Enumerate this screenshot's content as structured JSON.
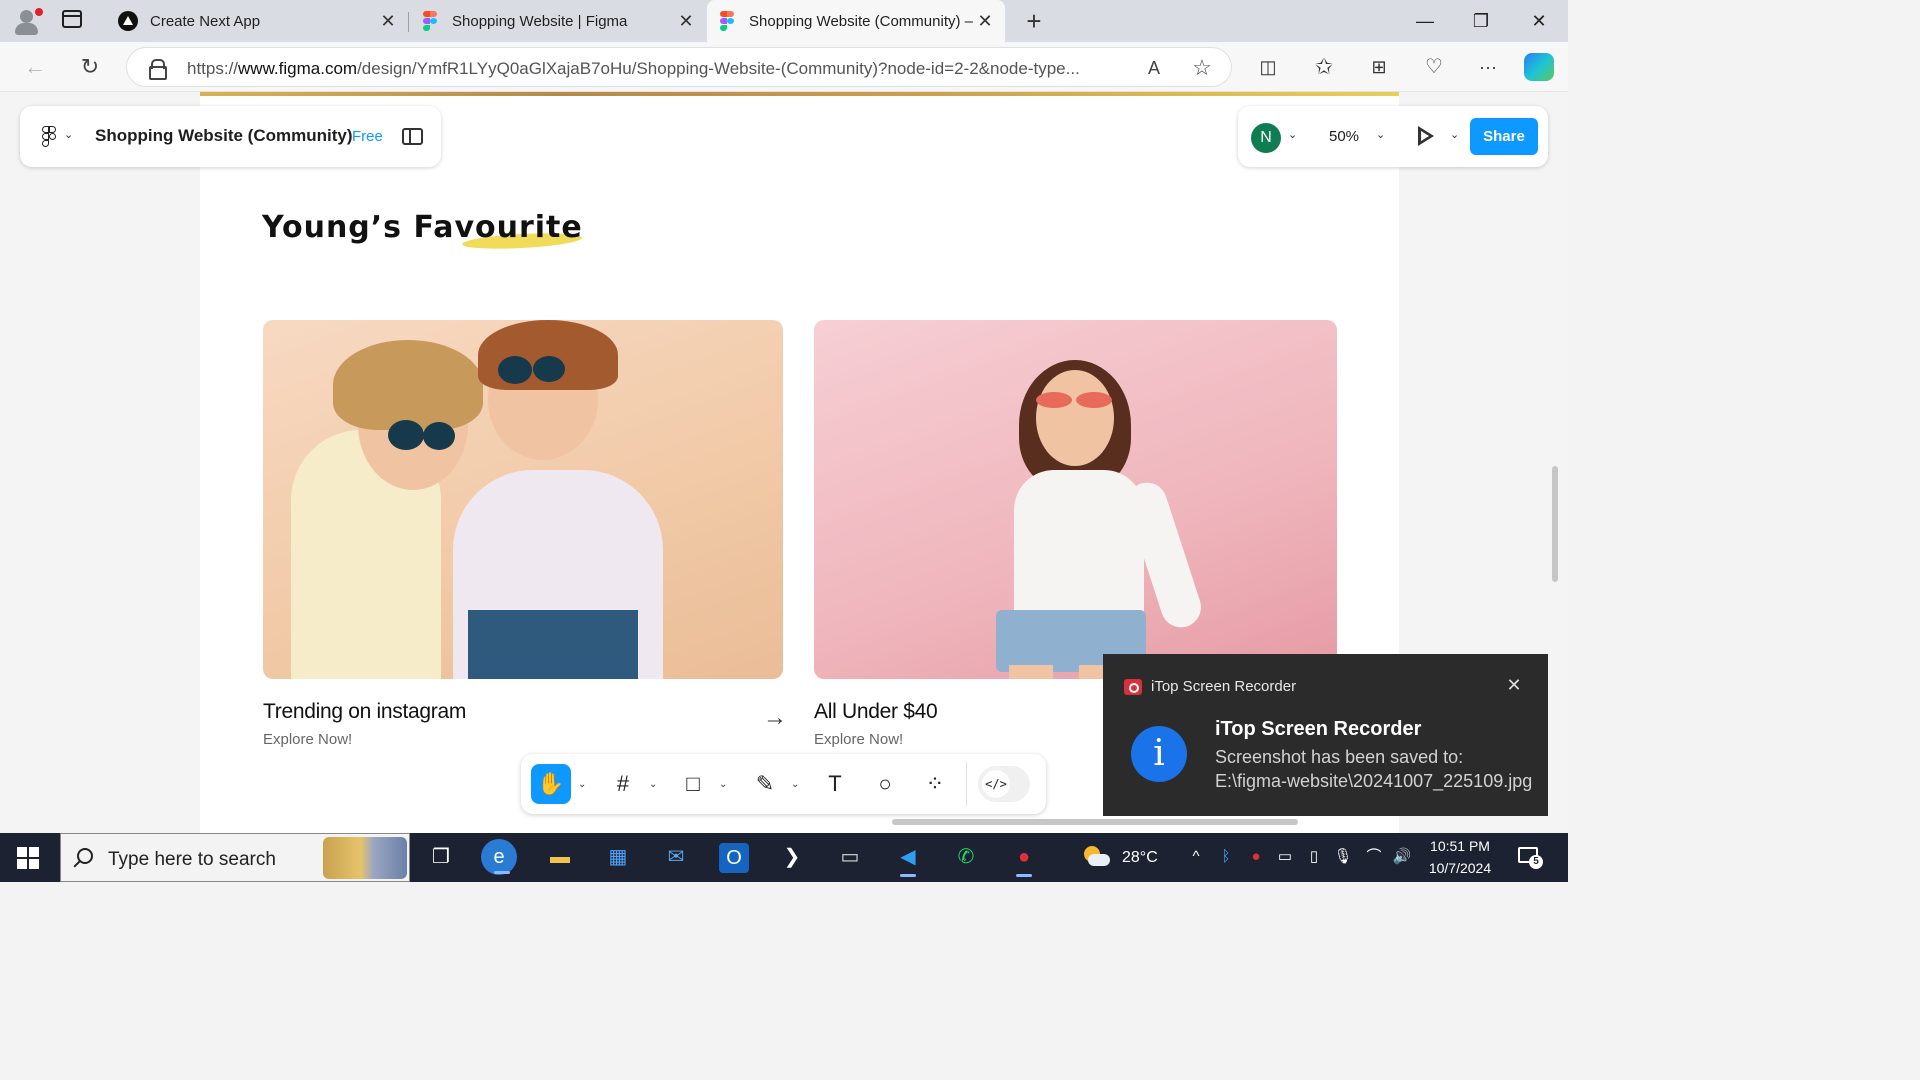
{
  "browser": {
    "tabs": [
      {
        "title": "Create Next App",
        "icon": "nextjs-icon",
        "active": false
      },
      {
        "title": "Shopping Website | Figma",
        "icon": "figma-icon",
        "active": false
      },
      {
        "title": "Shopping Website (Community) –",
        "icon": "figma-icon",
        "active": true
      }
    ],
    "url_prefix": "https://",
    "url_domain": "www.figma.com",
    "url_rest": "/design/YmfR1LYyQ0aGlXajaB7oHu/Shopping-Website-(Community)?node-id=2-2&node-type...",
    "icons": {
      "read_aloud": "A",
      "favorite": "☆",
      "split": "◫",
      "favorites": "✩",
      "collections": "⊞",
      "health": "♡",
      "more": "···"
    }
  },
  "figma": {
    "menu_icon": "figma-logo-icon",
    "file_name": "Shopping Website (Community)",
    "plan": "Free",
    "avatar_initial": "N",
    "zoom": "50%",
    "share_label": "Share",
    "accent_color": "#0d99ff",
    "tools": [
      {
        "name": "hand-tool",
        "glyph": "✋",
        "active": true
      },
      {
        "name": "frame-tool",
        "glyph": "#",
        "active": false
      },
      {
        "name": "shape-tool",
        "glyph": "□",
        "active": false
      },
      {
        "name": "pen-tool",
        "glyph": "✎",
        "active": false
      },
      {
        "name": "text-tool",
        "glyph": "T",
        "active": false
      },
      {
        "name": "comment-tool",
        "glyph": "○",
        "active": false
      },
      {
        "name": "actions-tool",
        "glyph": "⁘",
        "active": false
      }
    ],
    "dev_mode_glyph": "</>"
  },
  "canvas": {
    "section_title": "Young’s Favourite",
    "cards": [
      {
        "title": "Trending on instagram",
        "subtitle": "Explore Now!",
        "arrow": "→"
      },
      {
        "title": "All Under $40",
        "subtitle": "Explore Now!"
      }
    ]
  },
  "toast": {
    "app": "iTop Screen Recorder",
    "title": "iTop Screen Recorder",
    "body": "Screenshot has been saved to: E:\\figma-website\\20241007_225109.jpg",
    "close_glyph": "✕",
    "info_glyph": "i"
  },
  "taskbar": {
    "search_placeholder": "Type here to search",
    "weather_temp": "28°C",
    "time": "10:51 PM",
    "date": "10/7/2024",
    "notification_count": "5",
    "apps": [
      {
        "name": "task-view",
        "glyph": "❐"
      },
      {
        "name": "edge",
        "glyph": "e"
      },
      {
        "name": "file-explorer",
        "glyph": "▬"
      },
      {
        "name": "microsoft-store",
        "glyph": "▦"
      },
      {
        "name": "mail",
        "glyph": "✉"
      },
      {
        "name": "outlook",
        "glyph": "O"
      },
      {
        "name": "powershell",
        "glyph": "❯"
      },
      {
        "name": "terminal",
        "glyph": "▭"
      },
      {
        "name": "vscode",
        "glyph": "◀"
      },
      {
        "name": "whatsapp",
        "glyph": "✆"
      },
      {
        "name": "itop-recorder",
        "glyph": "●"
      }
    ]
  }
}
